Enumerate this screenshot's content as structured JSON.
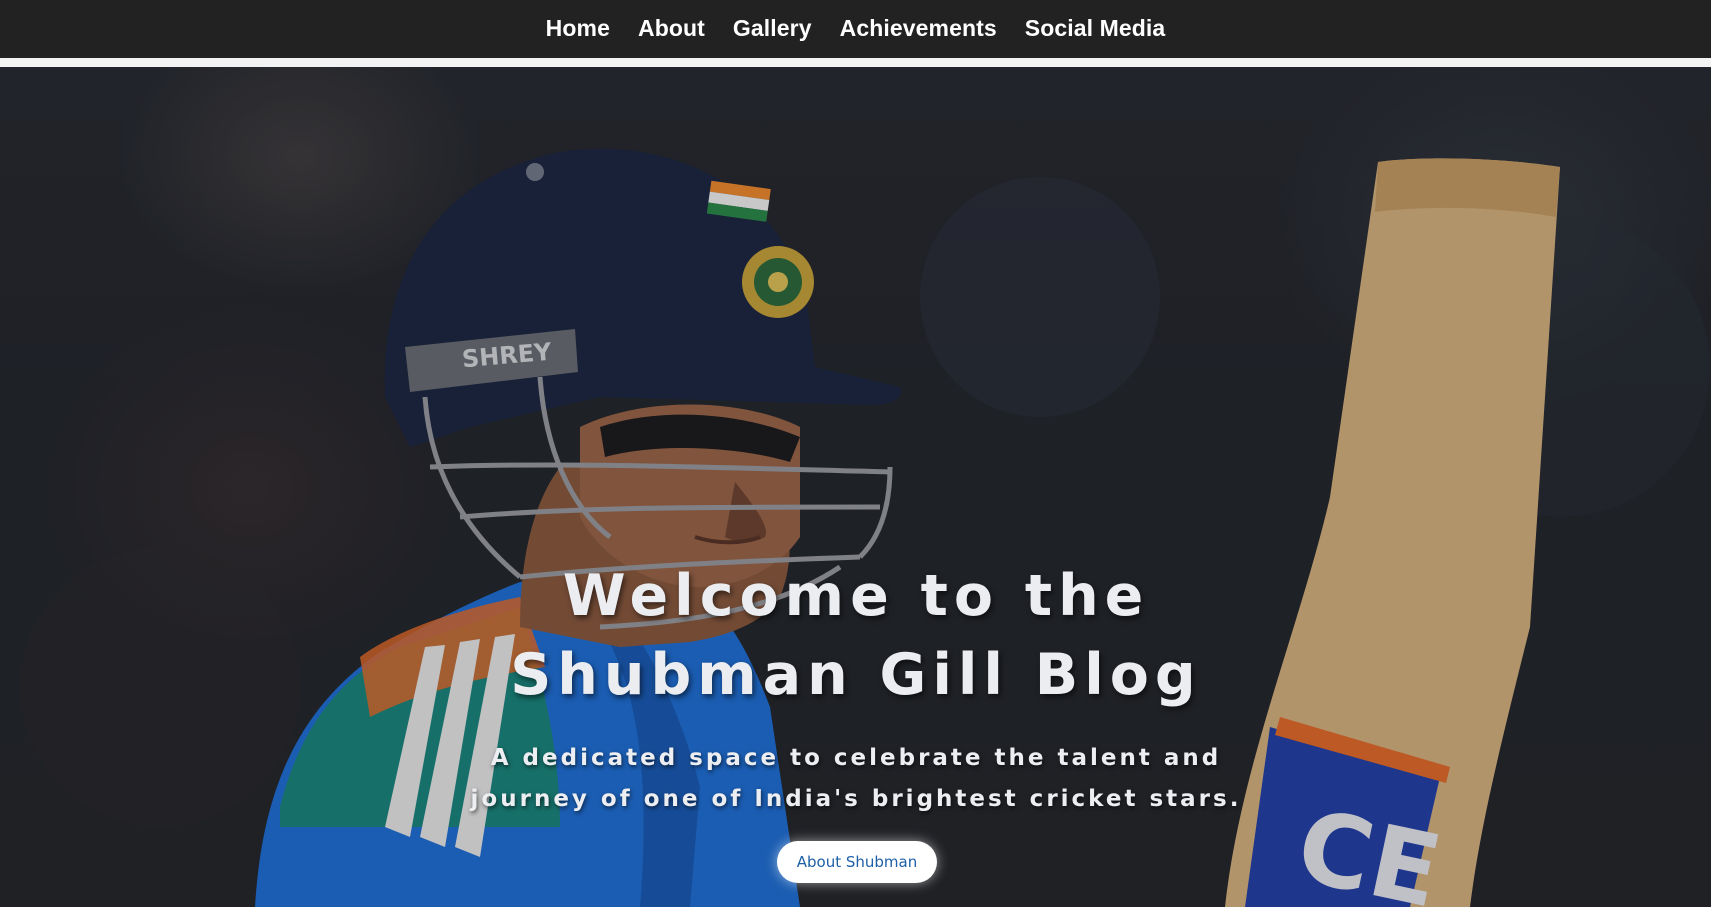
{
  "nav": {
    "items": [
      {
        "label": "Home"
      },
      {
        "label": "About"
      },
      {
        "label": "Gallery"
      },
      {
        "label": "Achievements"
      },
      {
        "label": "Social Media"
      }
    ]
  },
  "hero": {
    "title_line1": "Welcome to the",
    "title_line2": "Shubman Gill Blog",
    "subtitle_line1": "A dedicated space to celebrate the talent and",
    "subtitle_line2": "journey of one of India's brightest cricket stars.",
    "cta_label": "About Shubman",
    "helmet_brand": "SHREY",
    "bat_logo": "CE"
  },
  "colors": {
    "navbar_bg": "#222222",
    "nav_text": "#ffffff",
    "hero_text": "#ebedf0",
    "cta_text": "#1d5fa8",
    "jersey_blue": "#1f6fd6",
    "helmet_navy": "#1b2740"
  },
  "icons": [
    "india-flag-icon",
    "bcci-crest-icon"
  ]
}
